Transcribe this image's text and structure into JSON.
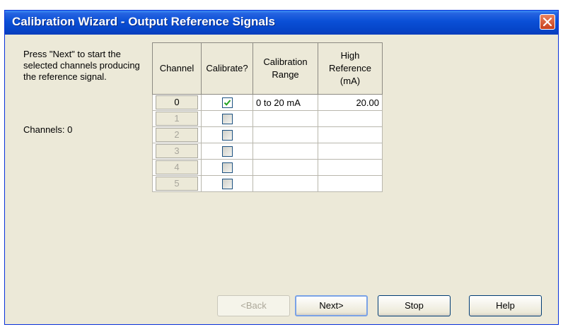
{
  "window": {
    "title": "Calibration Wizard - Output Reference Signals",
    "close_icon": "close-icon"
  },
  "instructions": "Press \"Next\" to start the selected channels producing the reference signal.",
  "channels_label": "Channels: 0",
  "table": {
    "headers": {
      "channel": "Channel",
      "calibrate": "Calibrate?",
      "range": "Calibration Range",
      "high": "High Reference (mA)"
    },
    "rows": [
      {
        "channel": "0",
        "calibrate": true,
        "range": "0 to 20 mA",
        "high": "20.00",
        "enabled": true
      },
      {
        "channel": "1",
        "calibrate": false,
        "range": "",
        "high": "",
        "enabled": false
      },
      {
        "channel": "2",
        "calibrate": false,
        "range": "",
        "high": "",
        "enabled": false
      },
      {
        "channel": "3",
        "calibrate": false,
        "range": "",
        "high": "",
        "enabled": false
      },
      {
        "channel": "4",
        "calibrate": false,
        "range": "",
        "high": "",
        "enabled": false
      },
      {
        "channel": "5",
        "calibrate": false,
        "range": "",
        "high": "",
        "enabled": false
      }
    ]
  },
  "buttons": {
    "back": "<Back",
    "next": "Next>",
    "stop": "Stop",
    "help": "Help"
  },
  "colors": {
    "titlebar": "#0a4fd6",
    "dialog_bg": "#ece9d8",
    "check": "#21a121"
  }
}
